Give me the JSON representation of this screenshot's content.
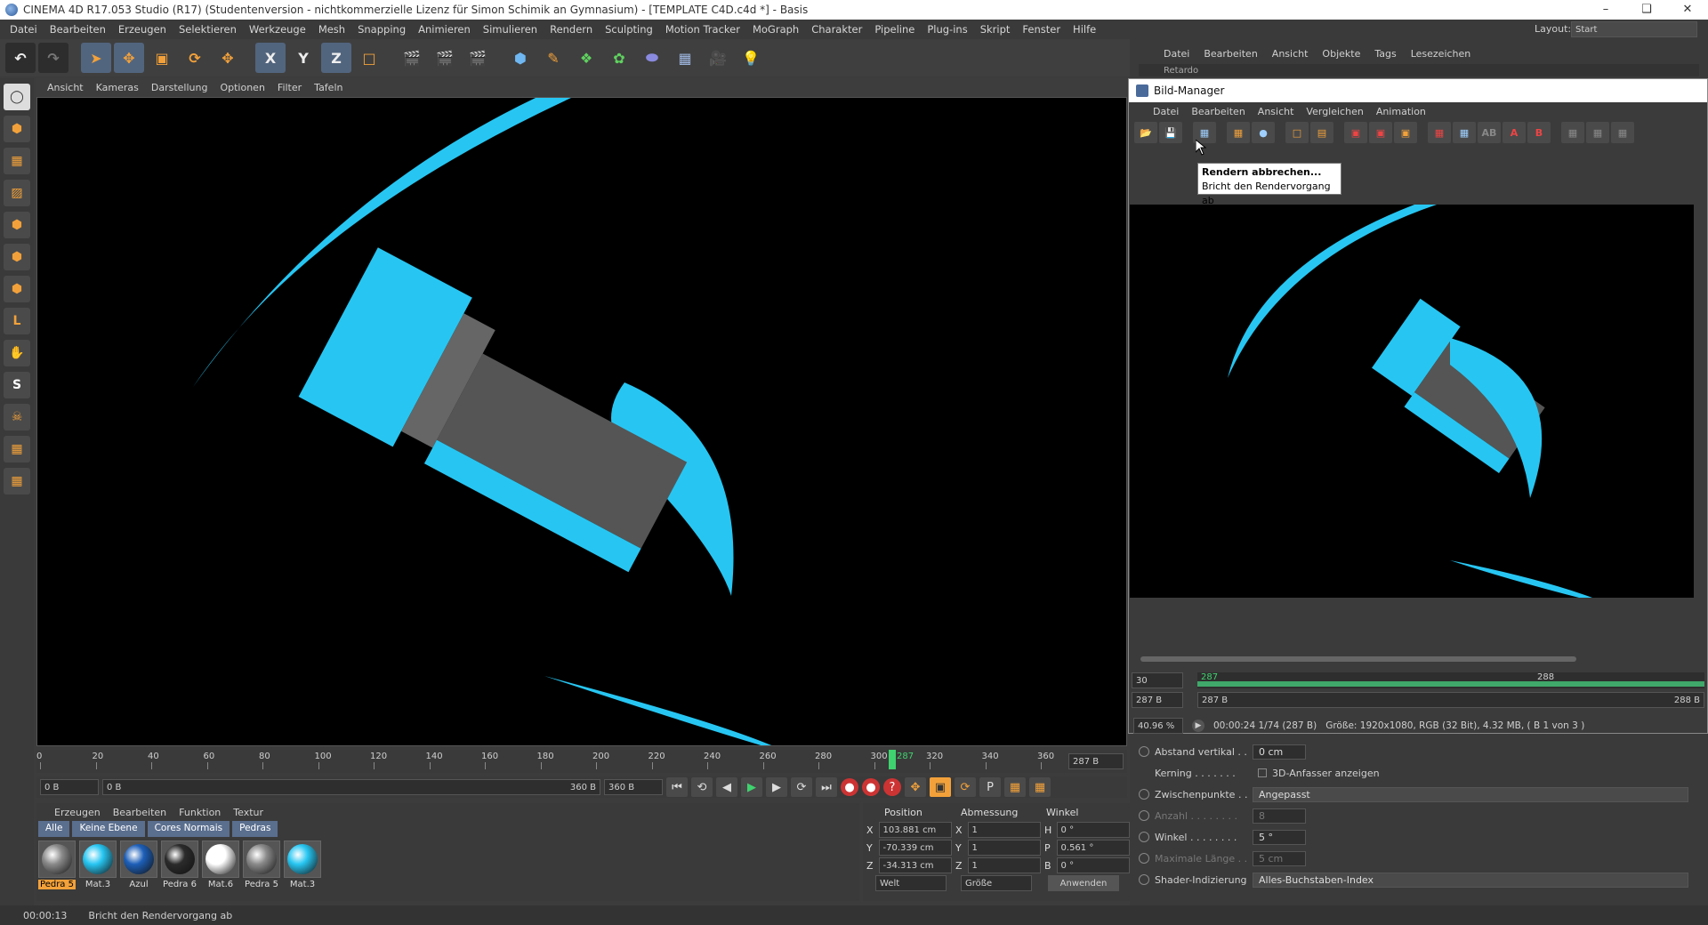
{
  "window": {
    "title": "CINEMA 4D R17.053 Studio (R17) (Studentenversion - nichtkommerzielle Lizenz für Simon Schimik an Gymnasium) - [TEMPLATE C4D.c4d *] - Basis"
  },
  "menu": [
    "Datei",
    "Bearbeiten",
    "Erzeugen",
    "Selektieren",
    "Werkzeuge",
    "Mesh",
    "Snapping",
    "Animieren",
    "Simulieren",
    "Rendern",
    "Sculpting",
    "Motion Tracker",
    "MoGraph",
    "Charakter",
    "Pipeline",
    "Plug-ins",
    "Skript",
    "Fenster",
    "Hilfe"
  ],
  "layout": {
    "label": "Layout:",
    "value": "Start"
  },
  "toolbar": {
    "x": "X",
    "y": "Y",
    "z": "Z"
  },
  "viewport_menu": [
    "Ansicht",
    "Kameras",
    "Darstellung",
    "Optionen",
    "Filter",
    "Tafeln"
  ],
  "timeline": {
    "ticks": [
      "0",
      "20",
      "40",
      "60",
      "80",
      "100",
      "120",
      "140",
      "160",
      "180",
      "200",
      "220",
      "240",
      "260",
      "280",
      "300",
      "320",
      "340",
      "360"
    ],
    "current": "287",
    "end_field": "287 B",
    "start_field": "0 B",
    "range_start": "0 B",
    "range_end": "360 B",
    "end2": "360 B"
  },
  "materials": {
    "menu": [
      "Erzeugen",
      "Bearbeiten",
      "Funktion",
      "Textur"
    ],
    "tabs": [
      "Alle",
      "Keine Ebene",
      "Cores Normais",
      "Pedras"
    ],
    "items": [
      {
        "name": "Pedra 5",
        "color": "#8a8a8a",
        "selected": true
      },
      {
        "name": "Mat.3",
        "color": "#27c6f2",
        "selected": false
      },
      {
        "name": "Azul",
        "color": "#1d5fb8",
        "selected": false
      },
      {
        "name": "Pedra 6",
        "color": "#2b2b2b",
        "selected": false
      },
      {
        "name": "Mat.6",
        "color": "#ffffff",
        "selected": false
      },
      {
        "name": "Pedra 5",
        "color": "#8a8a8a",
        "selected": false
      },
      {
        "name": "Mat.3",
        "color": "#27c6f2",
        "selected": false
      }
    ]
  },
  "coords": {
    "headers": [
      "Position",
      "Abmessung",
      "Winkel"
    ],
    "rows": [
      {
        "axis": "X",
        "pos": "103.881 cm",
        "ax2": "X",
        "size": "1",
        "ax3": "H",
        "angle": "0 °"
      },
      {
        "axis": "Y",
        "pos": "-70.339 cm",
        "ax2": "Y",
        "size": "1",
        "ax3": "P",
        "angle": "0.561 °"
      },
      {
        "axis": "Z",
        "pos": "-34.313 cm",
        "ax2": "Z",
        "size": "1",
        "ax3": "B",
        "angle": "0 °"
      }
    ],
    "world": "Welt",
    "size_mode": "Größe",
    "apply": "Anwenden"
  },
  "status": {
    "time": "00:00:13",
    "message": "Bricht den Rendervorgang ab"
  },
  "object_manager_menu": [
    "Datei",
    "Bearbeiten",
    "Ansicht",
    "Objekte",
    "Tags",
    "Lesezeichen"
  ],
  "object_row": "Retardo",
  "attributes": {
    "abstand_vertikal": {
      "label": "Abstand vertikal . .",
      "value": "0 cm"
    },
    "kerning": {
      "label": "Kerning . . . . . . .",
      "checkbox": "3D-Anfasser anzeigen"
    },
    "zwischenpunkte": {
      "label": "Zwischenpunkte . .",
      "value": "Angepasst"
    },
    "anzahl": {
      "label": "Anzahl . . . . . . . .",
      "value": "8"
    },
    "winkel": {
      "label": "Winkel . . . . . . . .",
      "value": "5 °"
    },
    "maximale_laenge": {
      "label": "Maximale Länge . .",
      "value": "5 cm"
    },
    "shader": {
      "label": "Shader-Indizierung",
      "value": "Alles-Buchstaben-Index"
    }
  },
  "bild_manager": {
    "title": "Bild-Manager",
    "menu": [
      "Datei",
      "Bearbeiten",
      "Ansicht",
      "Vergleichen",
      "Animation"
    ],
    "tooltip_title": "Rendern abbrechen...",
    "tooltip_desc": "Bricht den Rendervorgang ab",
    "fps": "30",
    "frame_field": "287 B",
    "frame_marker": "287",
    "frame_next": "288",
    "range_left": "287 B",
    "range_right": "288 B",
    "zoom": "40.96 %",
    "timecode": "00:00:24 1/74 (287 B)",
    "info": "Größe: 1920x1080, RGB (32 Bit), 4.32 MB,  ( B 1 von 3 )"
  },
  "colors": {
    "accent": "#f2a13a",
    "cyan": "#27c6f2",
    "selection": "#52657e"
  }
}
